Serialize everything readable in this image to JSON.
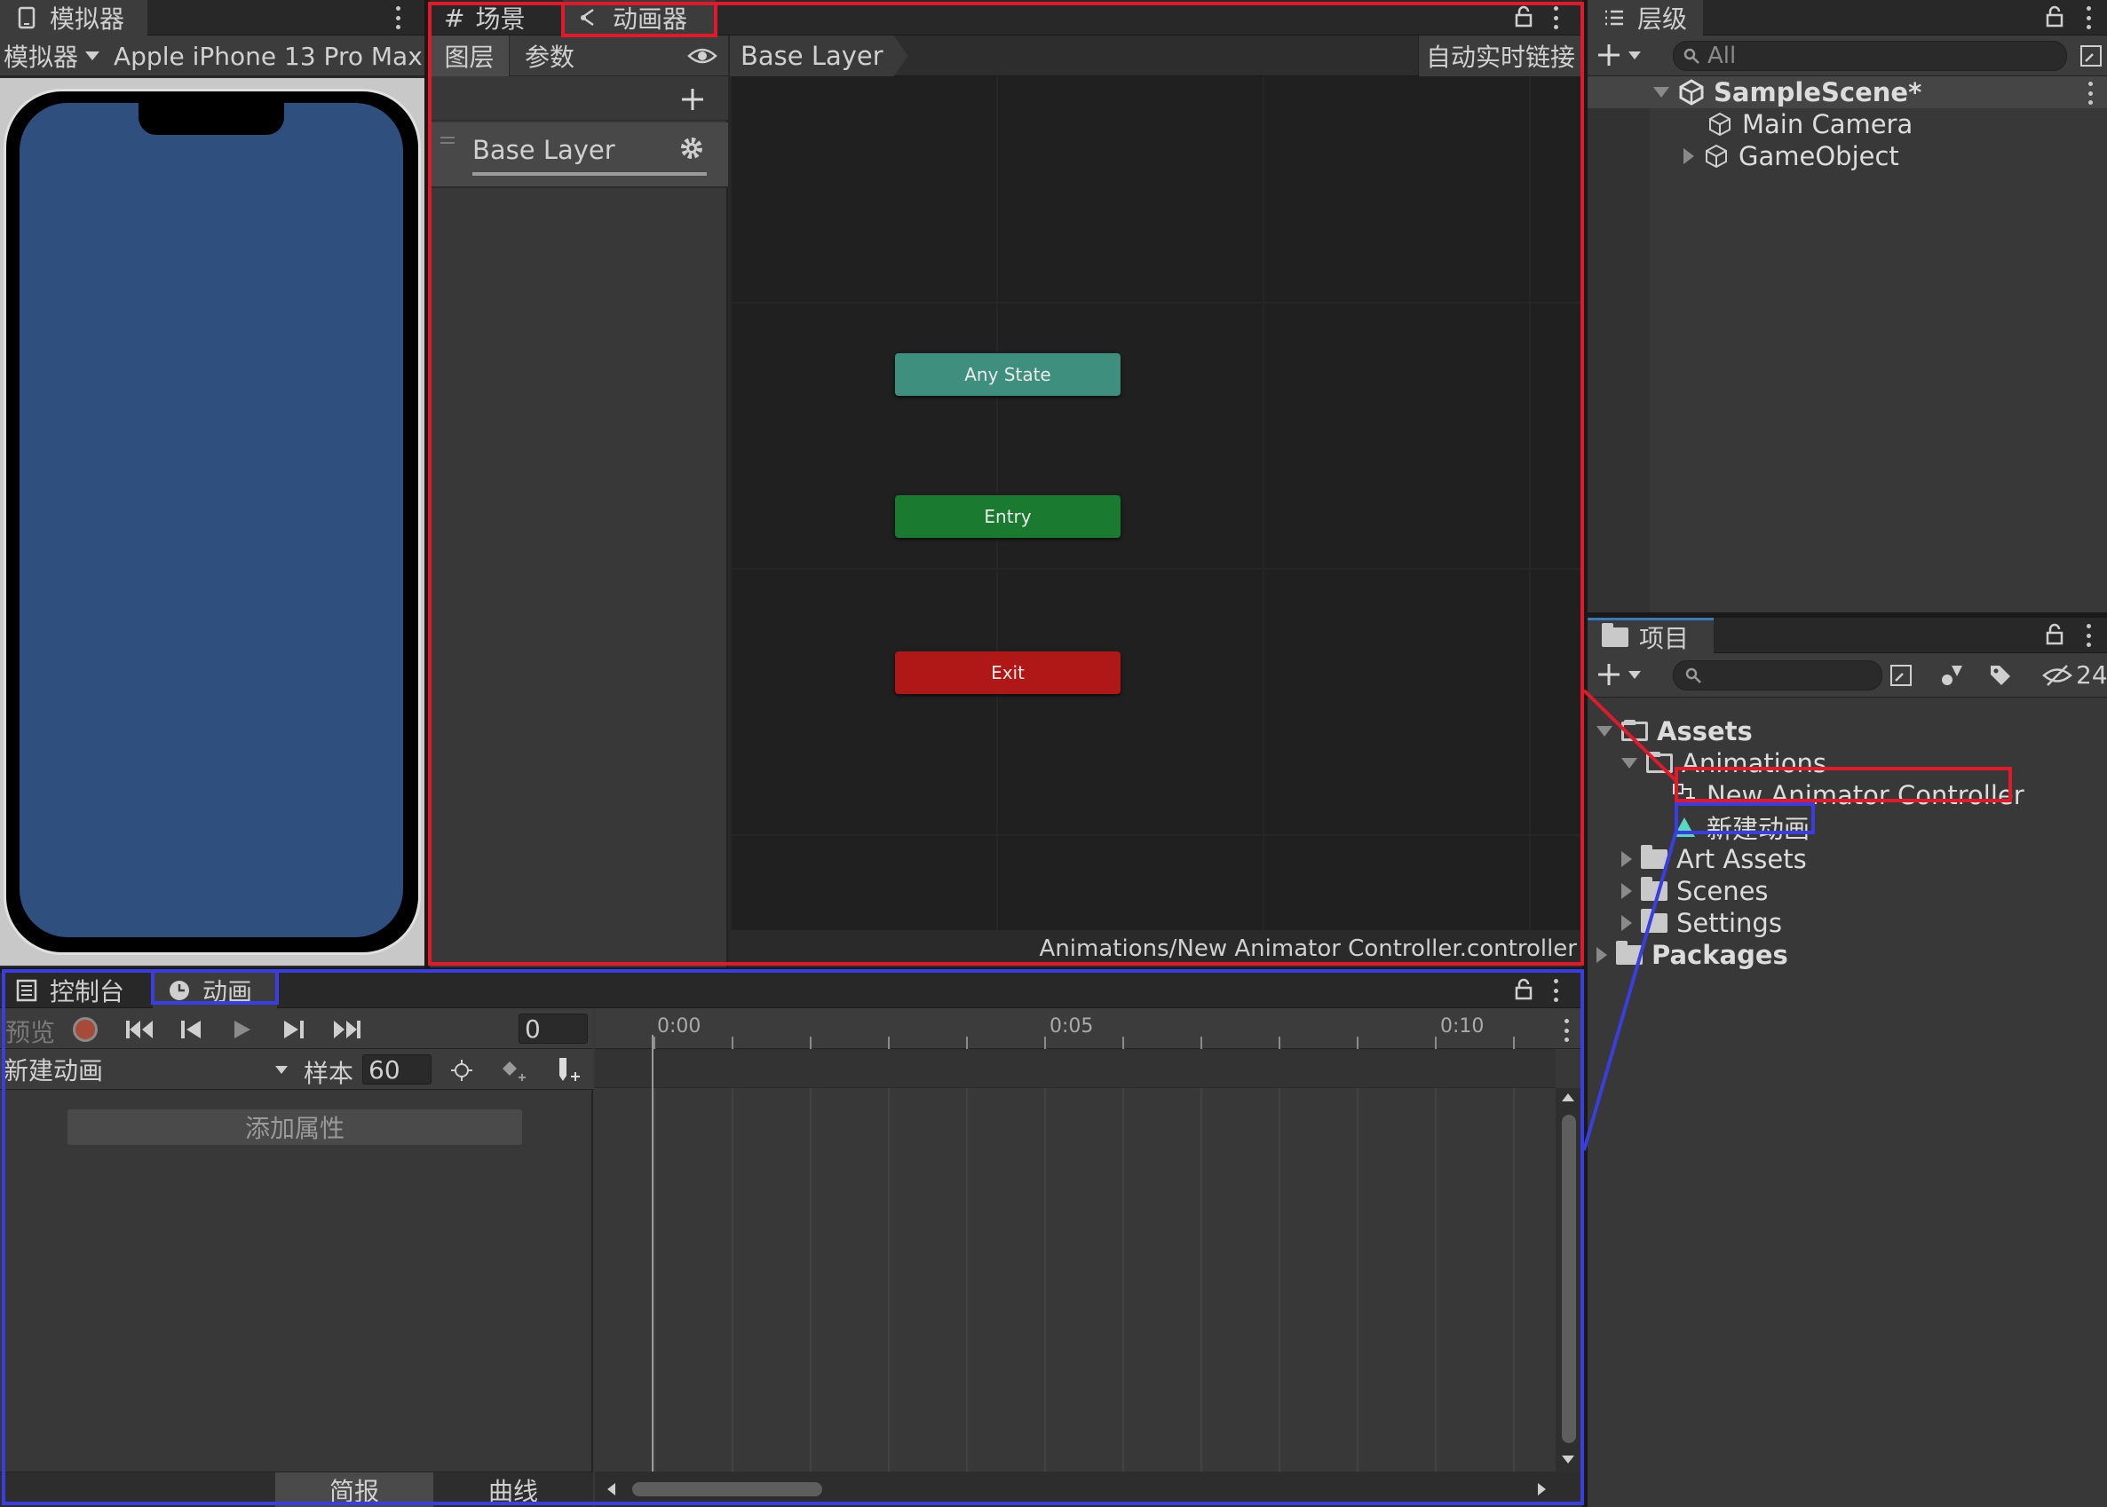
{
  "simulator": {
    "tab_label": "模拟器",
    "mode_dropdown": "模拟器",
    "device_dropdown": "Apple iPhone 13 Pro Max",
    "screen_color": "#2f4f7f"
  },
  "scene_tabs": {
    "scene_label": "场景",
    "animator_label": "动画器"
  },
  "animator": {
    "layers_tab": "图层",
    "params_tab": "参数",
    "layer_name": "Base Layer",
    "breadcrumb": "Base Layer",
    "auto_live_link": "自动实时链接",
    "states": {
      "any_state": "Any State",
      "entry": "Entry",
      "exit": "Exit"
    },
    "status_path": "Animations/New Animator Controller.controller"
  },
  "hierarchy": {
    "tab_label": "层级",
    "search_placeholder": "All",
    "scene_name": "SampleScene*",
    "items": [
      "Main Camera",
      "GameObject"
    ]
  },
  "project": {
    "tab_label": "项目",
    "hidden_count": "24",
    "tree": {
      "assets": "Assets",
      "animations": "Animations",
      "controller": "New Animator Controller",
      "clip": "新建动画",
      "art_assets": "Art Assets",
      "scenes": "Scenes",
      "settings": "Settings",
      "packages": "Packages"
    }
  },
  "bottom_tabs": {
    "console_label": "控制台",
    "animation_label": "动画"
  },
  "animation": {
    "preview_label": "预览",
    "frame_value": "0",
    "clip_dropdown": "新建动画",
    "samples_label": "样本",
    "samples_value": "60",
    "add_property": "添加属性",
    "dopesheet_tab": "简报",
    "curves_tab": "曲线",
    "ruler": [
      "0:00",
      "0:05",
      "0:10"
    ]
  },
  "colors": {
    "any_state": "#3f8f7f",
    "entry": "#1a7a30",
    "exit": "#b01818",
    "highlight_red": "#e01a2a",
    "highlight_blue": "#3a3ee0"
  }
}
